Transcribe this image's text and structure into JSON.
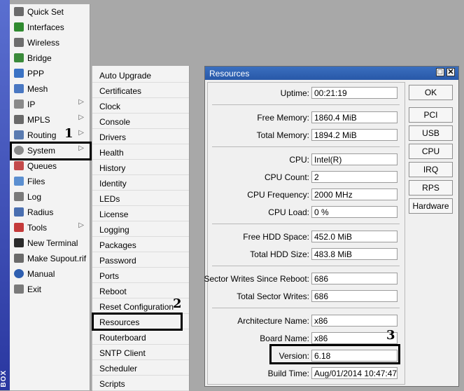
{
  "brand": {
    "strip_text": "BOX",
    "color": "#3a4bbd"
  },
  "menu": {
    "items": [
      {
        "label": "Quick Set",
        "icon": "quick-set-icon",
        "color": "#6b6b6b",
        "has_submenu": false
      },
      {
        "label": "Interfaces",
        "icon": "interfaces-icon",
        "color": "#2f8a2f",
        "has_submenu": false
      },
      {
        "label": "Wireless",
        "icon": "wireless-icon",
        "color": "#6d6d6d",
        "has_submenu": false
      },
      {
        "label": "Bridge",
        "icon": "bridge-icon",
        "color": "#3a8a3a",
        "has_submenu": false
      },
      {
        "label": "PPP",
        "icon": "ppp-icon",
        "color": "#3b73c4",
        "has_submenu": false
      },
      {
        "label": "Mesh",
        "icon": "mesh-icon",
        "color": "#4a78c2",
        "has_submenu": false
      },
      {
        "label": "IP",
        "icon": "ip-icon",
        "color": "#8a8a8a",
        "has_submenu": true
      },
      {
        "label": "MPLS",
        "icon": "mpls-icon",
        "color": "#6a6a6a",
        "has_submenu": true
      },
      {
        "label": "Routing",
        "icon": "routing-icon",
        "color": "#5a7bb0",
        "has_submenu": true
      },
      {
        "label": "System",
        "icon": "gear-icon",
        "color": "#8a8a8a",
        "has_submenu": true
      },
      {
        "label": "Queues",
        "icon": "queues-icon",
        "color": "#c34a4a",
        "has_submenu": false
      },
      {
        "label": "Files",
        "icon": "files-icon",
        "color": "#5b8fd0",
        "has_submenu": false
      },
      {
        "label": "Log",
        "icon": "log-icon",
        "color": "#7a7a7a",
        "has_submenu": false
      },
      {
        "label": "Radius",
        "icon": "radius-icon",
        "color": "#4a6fb0",
        "has_submenu": false
      },
      {
        "label": "Tools",
        "icon": "tools-icon",
        "color": "#c43a3a",
        "has_submenu": true
      },
      {
        "label": "New Terminal",
        "icon": "terminal-icon",
        "color": "#2a2a2a",
        "has_submenu": false
      },
      {
        "label": "Make Supout.rif",
        "icon": "supout-icon",
        "color": "#6a6a6a",
        "has_submenu": false
      },
      {
        "label": "Manual",
        "icon": "manual-icon",
        "color": "#2f5fb0",
        "has_submenu": false
      },
      {
        "label": "Exit",
        "icon": "exit-icon",
        "color": "#7a7a7a",
        "has_submenu": false
      }
    ],
    "arrow_glyph": "▷"
  },
  "submenu": {
    "items": [
      "Auto Upgrade",
      "Certificates",
      "Clock",
      "Console",
      "Drivers",
      "Health",
      "History",
      "Identity",
      "LEDs",
      "License",
      "Logging",
      "Packages",
      "Password",
      "Ports",
      "Reboot",
      "Reset Configuration",
      "Resources",
      "Routerboard",
      "SNTP Client",
      "Scheduler",
      "Scripts"
    ]
  },
  "annotations": {
    "step1": "1",
    "step2": "2",
    "step3": "3"
  },
  "window": {
    "title": "Resources",
    "restore_glyph": "□",
    "close_glyph": "✕",
    "fields": {
      "uptime": {
        "label": "Uptime:",
        "value": "00:21:19"
      },
      "free_memory": {
        "label": "Free Memory:",
        "value": "1860.4 MiB"
      },
      "total_memory": {
        "label": "Total Memory:",
        "value": "1894.2 MiB"
      },
      "cpu": {
        "label": "CPU:",
        "value": "Intel(R)"
      },
      "cpu_count": {
        "label": "CPU Count:",
        "value": "2"
      },
      "cpu_frequency": {
        "label": "CPU Frequency:",
        "value": "2000 MHz"
      },
      "cpu_load": {
        "label": "CPU Load:",
        "value": "0 %"
      },
      "free_hdd": {
        "label": "Free HDD Space:",
        "value": "452.0 MiB"
      },
      "total_hdd": {
        "label": "Total HDD Size:",
        "value": "483.8 MiB"
      },
      "sector_writes_reboot": {
        "label": "Sector Writes Since Reboot:",
        "value": "686"
      },
      "total_sector_writes": {
        "label": "Total Sector Writes:",
        "value": "686"
      },
      "architecture": {
        "label": "Architecture Name:",
        "value": "x86"
      },
      "board_name": {
        "label": "Board Name:",
        "value": "x86"
      },
      "version": {
        "label": "Version:",
        "value": "6.18"
      },
      "build_time": {
        "label": "Build Time:",
        "value": "Aug/01/2014 10:47:47"
      }
    },
    "buttons": {
      "ok": "OK",
      "pci": "PCI",
      "usb": "USB",
      "cpu": "CPU",
      "irq": "IRQ",
      "rps": "RPS",
      "hardware": "Hardware"
    }
  }
}
